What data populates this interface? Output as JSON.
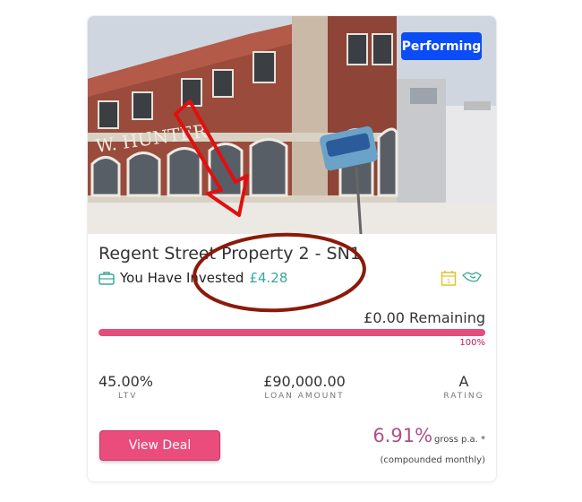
{
  "badge": "Performing",
  "property": {
    "title": "Regent Street Property 2 - SN1",
    "invested_label": "You Have Invested",
    "invested_amount": "£4.28"
  },
  "funding": {
    "remaining": "£0.00 Remaining",
    "percent_label": "100%",
    "progress_percent": 100
  },
  "stats": [
    {
      "value": "45.00%",
      "label": "LTV"
    },
    {
      "value": "£90,000.00",
      "label": "LOAN AMOUNT"
    },
    {
      "value": "A",
      "label": "RATING"
    }
  ],
  "actions": {
    "view_deal": "View Deal"
  },
  "rate": {
    "value": "6.91%",
    "suffix": "gross p.a. *",
    "note": "(compounded monthly)"
  },
  "photo_sign_text": "W. HUNTER",
  "colors": {
    "badge": "#0a4cf5",
    "accent": "#e34e7c",
    "invested_amount": "#3aa89a",
    "rate": "#b04f86",
    "annotation_arrow": "#e01010",
    "annotation_circle": "#8b1a0a"
  }
}
